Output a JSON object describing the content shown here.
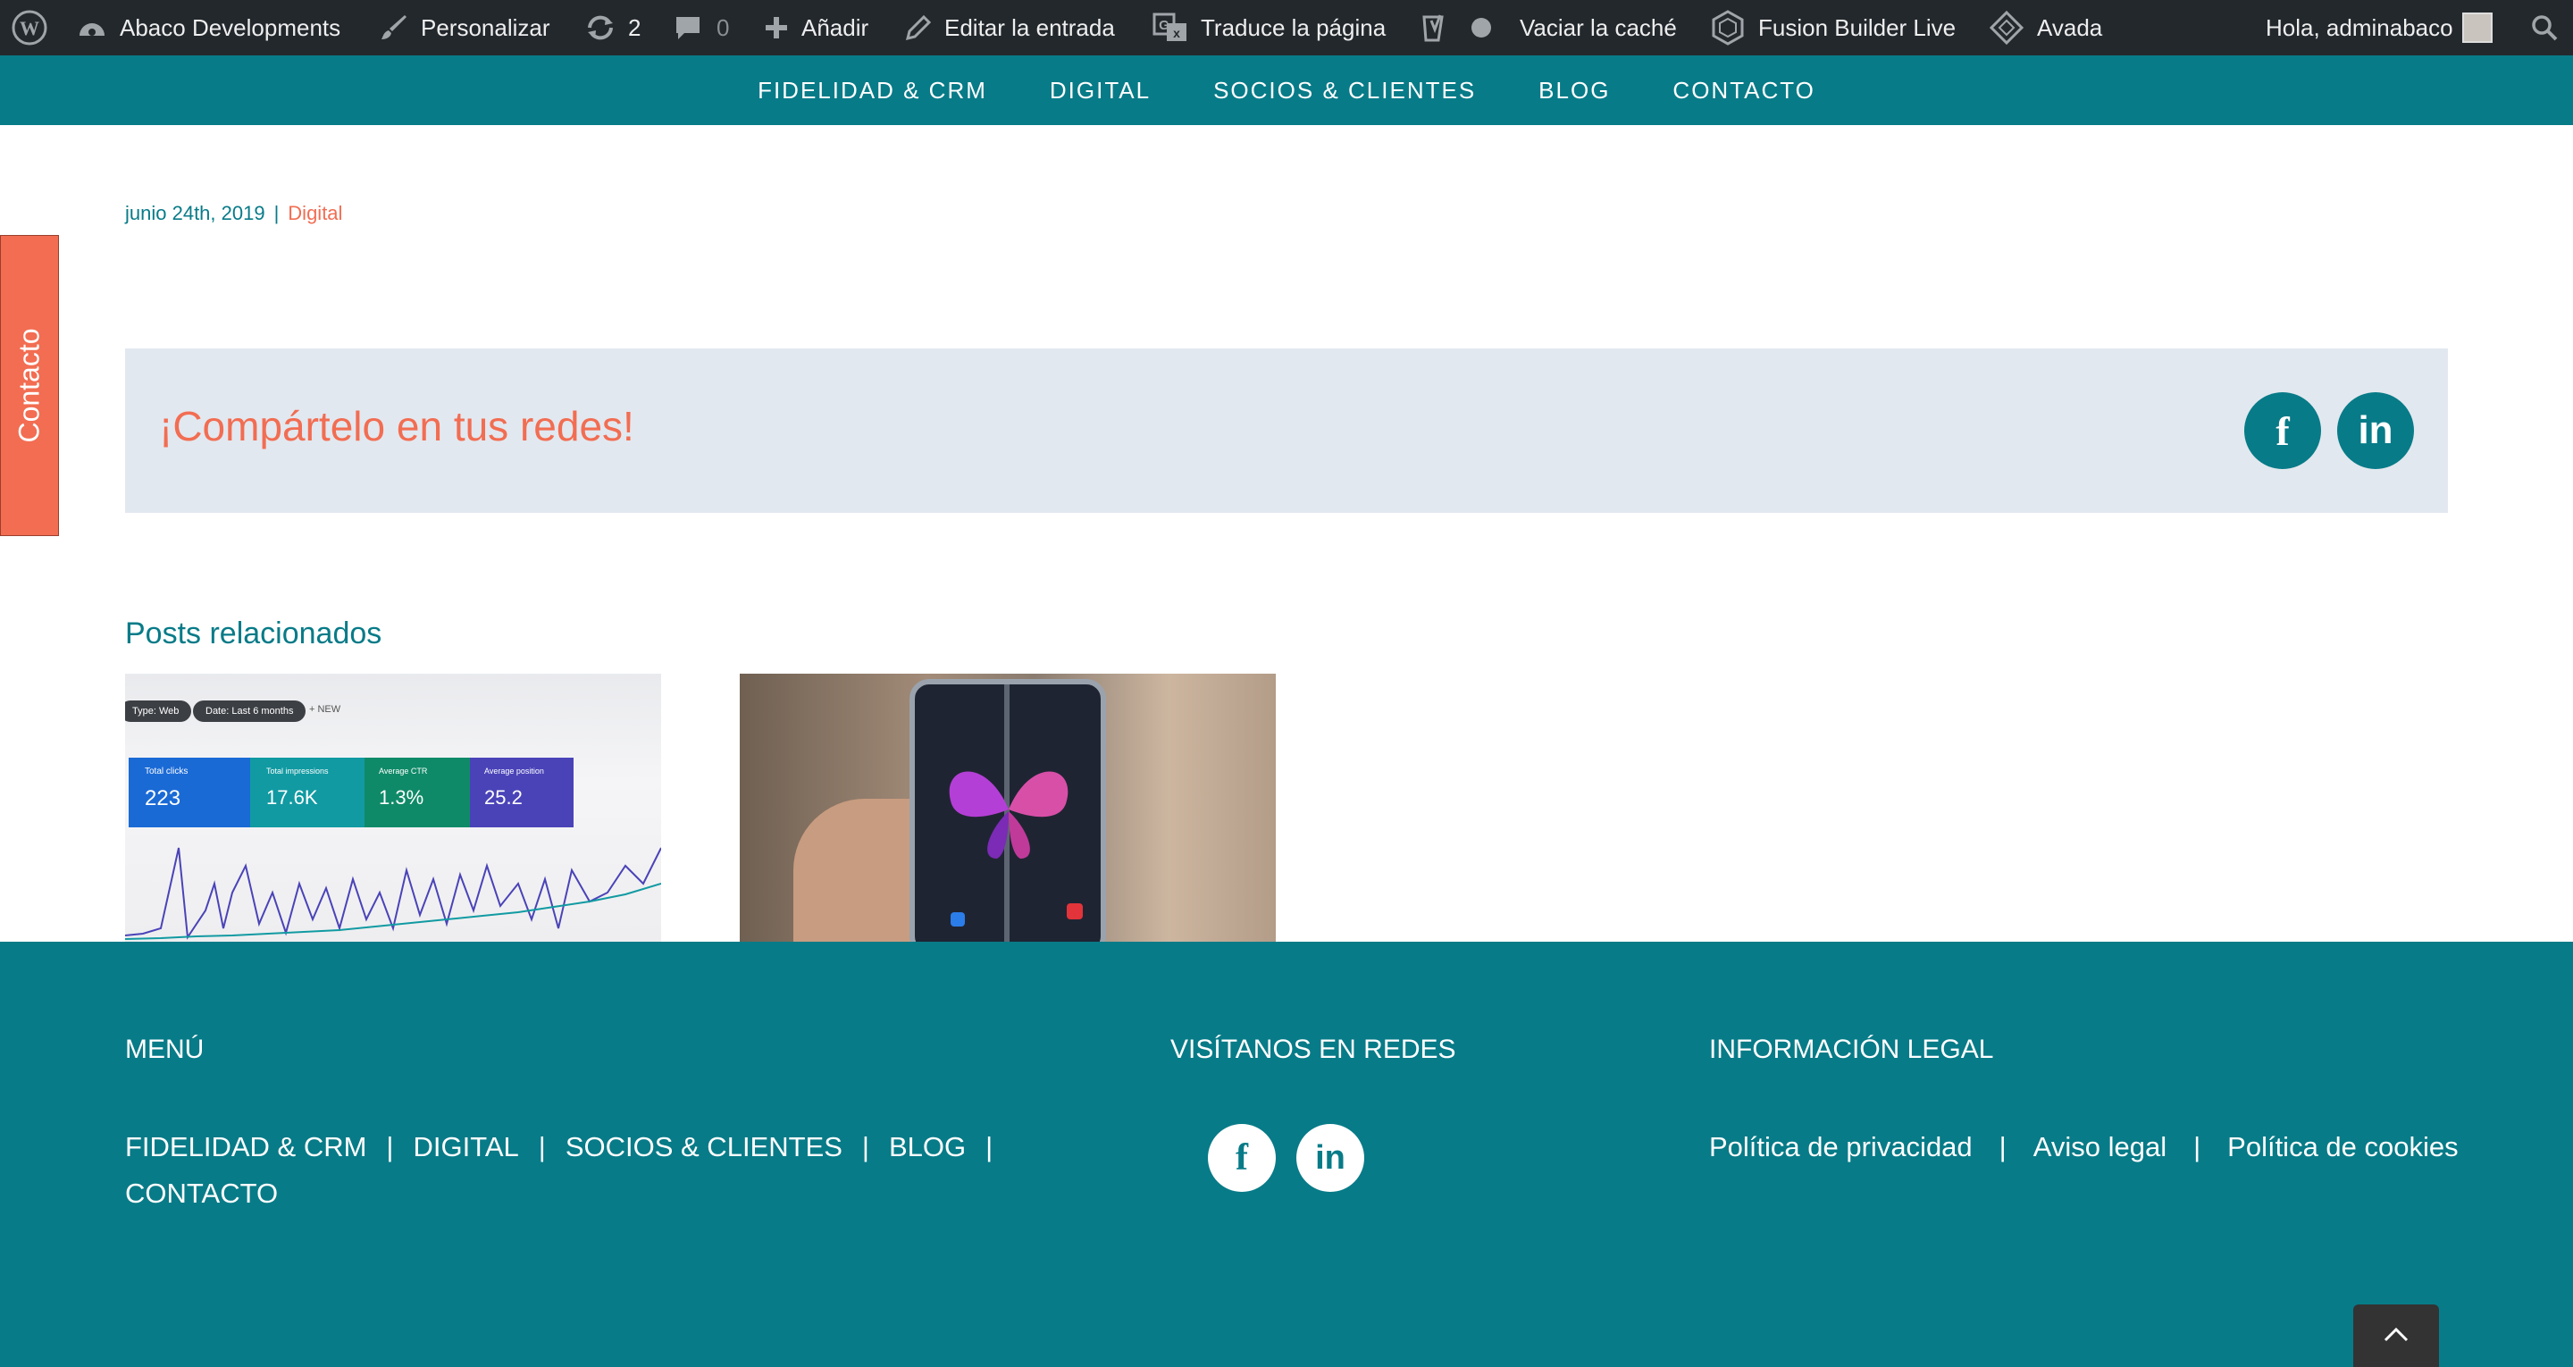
{
  "adminbar": {
    "site_name": "Abaco Developments",
    "customize": "Personalizar",
    "updates_count": "2",
    "comments_count": "0",
    "add_new": "Añadir",
    "edit_post": "Editar la entrada",
    "translate": "Traduce la página",
    "clear_cache": "Vaciar la caché",
    "fusion_builder": "Fusion Builder Live",
    "avada": "Avada",
    "greeting": "Hola, adminabaco"
  },
  "nav": {
    "items": [
      "FIDELIDAD & CRM",
      "DIGITAL",
      "SOCIOS & CLIENTES",
      "BLOG",
      "CONTACTO"
    ]
  },
  "post": {
    "date": "junio 24th, 2019",
    "separator": "|",
    "category": "Digital"
  },
  "sidetab": {
    "label": "Contacto"
  },
  "share": {
    "title": "¡Compártelo en tus redes!",
    "facebook_glyph": "f",
    "linkedin_glyph": "in"
  },
  "related": {
    "title": "Posts relacionados",
    "post1": {
      "chip1": "Type: Web",
      "chip2": "Date: Last 6 months",
      "new": "NEW",
      "metrics": [
        {
          "label": "Total clicks",
          "value": "223"
        },
        {
          "label": "Total impressions",
          "value": "17.6K"
        },
        {
          "label": "Average CTR",
          "value": "1.3%"
        },
        {
          "label": "Average position",
          "value": "25.2"
        }
      ]
    }
  },
  "footer": {
    "menu_heading": "MENÚ",
    "menu_links": [
      "FIDELIDAD & CRM",
      "DIGITAL",
      "SOCIOS & CLIENTES",
      "BLOG",
      "CONTACTO"
    ],
    "social_heading": "VISÍTANOS EN REDES",
    "legal_heading": "INFORMACIÓN LEGAL",
    "legal_links": [
      "Política de privacidad",
      "Aviso legal",
      "Política de cookies"
    ],
    "bar": "|"
  },
  "colors": {
    "teal": "#087b88",
    "coral": "#f26d52",
    "adminbar": "#23282d",
    "share_bg": "#e2e8ef"
  }
}
